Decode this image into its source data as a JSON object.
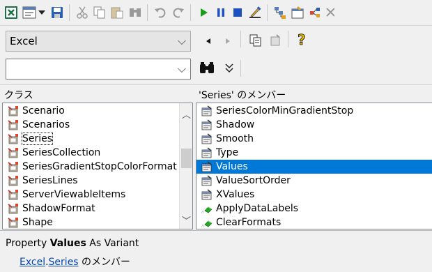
{
  "toolbar": {
    "buttons": [
      "excel-icon",
      "view-object-icon",
      "dropdown-arrow-icon",
      "save-icon",
      "cut-icon",
      "copy-icon",
      "paste-icon",
      "find-icon",
      "undo-icon",
      "redo-icon",
      "run-icon",
      "pause-icon",
      "stop-icon",
      "design-mode-icon",
      "project-explorer-icon",
      "properties-icon",
      "object-browser-icon",
      "more-icon"
    ],
    "colors": {
      "run": "#1a9c1a",
      "pause": "#1f4fbf",
      "stop": "#1f4fbf"
    }
  },
  "library_combo": {
    "value": "Excel"
  },
  "search_combo": {
    "value": ""
  },
  "classes": {
    "header": "クラス",
    "items": [
      "Scenario",
      "Scenarios",
      "Series",
      "SeriesCollection",
      "SeriesGradientStopColorFormat",
      "SeriesLines",
      "ServerViewableItems",
      "ShadowFormat",
      "Shape"
    ],
    "selected": "Series"
  },
  "members": {
    "header": "'Series' のメンバー",
    "items": [
      {
        "label": "SeriesColorMinGradientStop",
        "kind": "property"
      },
      {
        "label": "Shadow",
        "kind": "property"
      },
      {
        "label": "Smooth",
        "kind": "property"
      },
      {
        "label": "Type",
        "kind": "property"
      },
      {
        "label": "Values",
        "kind": "property"
      },
      {
        "label": "ValueSortOrder",
        "kind": "property"
      },
      {
        "label": "XValues",
        "kind": "property"
      },
      {
        "label": "ApplyDataLabels",
        "kind": "method"
      },
      {
        "label": "ClearFormats",
        "kind": "method"
      }
    ],
    "selected": "Values",
    "highlight_color": "#0078d7"
  },
  "detail": {
    "prefix": "Property ",
    "name": "Values",
    "suffix": " As Variant",
    "library_link": "Excel",
    "dot": ".",
    "class_link": "Series",
    "member_of": " のメンバー"
  }
}
